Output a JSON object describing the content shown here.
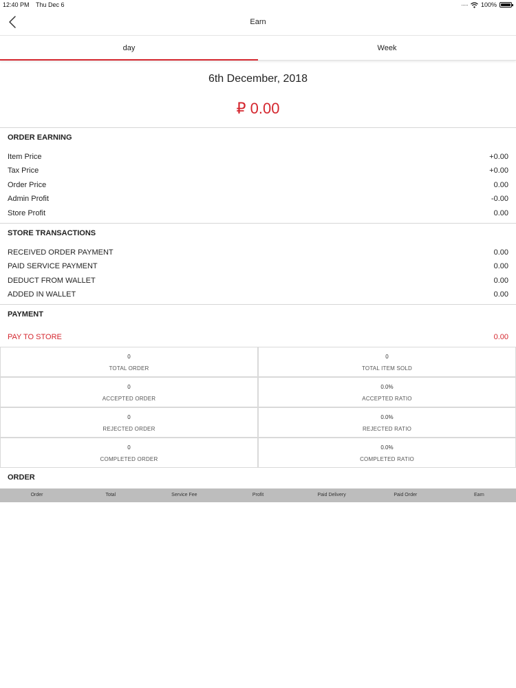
{
  "status_bar": {
    "time": "12:40 PM",
    "date": "Thu Dec 6",
    "battery": "100%"
  },
  "nav": {
    "title": "Earn"
  },
  "tabs": [
    {
      "label": "day",
      "active": true
    },
    {
      "label": "Week",
      "active": false
    }
  ],
  "summary": {
    "date": "6th December, 2018",
    "total": "₽ 0.00"
  },
  "order_earning": {
    "title": "ORDER EARNING",
    "rows": [
      {
        "label": "Item Price",
        "value": "+0.00"
      },
      {
        "label": "Tax Price",
        "value": "+0.00"
      },
      {
        "label": "Order Price",
        "value": "0.00"
      },
      {
        "label": "Admin Profit",
        "value": "-0.00"
      },
      {
        "label": "Store Profit",
        "value": "0.00"
      }
    ]
  },
  "store_transactions": {
    "title": "STORE TRANSACTIONS",
    "rows": [
      {
        "label": "RECEIVED ORDER PAYMENT",
        "value": "0.00"
      },
      {
        "label": "PAID SERVICE PAYMENT",
        "value": "0.00"
      },
      {
        "label": "DEDUCT FROM WALLET",
        "value": "0.00"
      },
      {
        "label": "ADDED IN WALLET",
        "value": "0.00"
      }
    ]
  },
  "payment": {
    "title": "PAYMENT",
    "pay_to_store_label": "PAY TO STORE",
    "pay_to_store_value": "0.00"
  },
  "stats": [
    {
      "value": "0",
      "label": "TOTAL ORDER"
    },
    {
      "value": "0",
      "label": "TOTAL ITEM SOLD"
    },
    {
      "value": "0",
      "label": "ACCEPTED ORDER"
    },
    {
      "value": "0.0%",
      "label": "ACCEPTED RATIO"
    },
    {
      "value": "0",
      "label": "REJECTED ORDER"
    },
    {
      "value": "0.0%",
      "label": "REJECTED RATIO"
    },
    {
      "value": "0",
      "label": "COMPLETED ORDER"
    },
    {
      "value": "0.0%",
      "label": "COMPLETED RATIO"
    }
  ],
  "order": {
    "title": "ORDER",
    "columns": [
      "Order",
      "Total",
      "Service Fee",
      "Profit",
      "Paid Delivery",
      "Paid Order",
      "Earn"
    ]
  },
  "colors": {
    "accent": "#d4262e",
    "table_header": "#bdbdbd",
    "divider": "#d6d6d6"
  },
  "icons": {
    "back": "chevron-left-icon",
    "wifi": "wifi-icon",
    "battery": "battery-icon"
  }
}
